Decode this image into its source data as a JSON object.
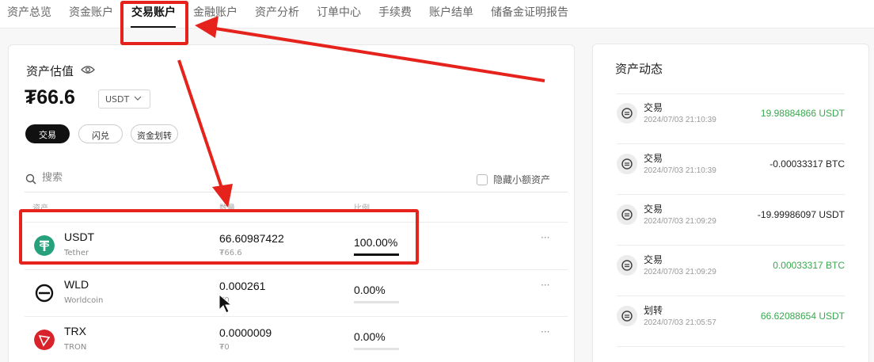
{
  "tabs": [
    {
      "label": "资产总览"
    },
    {
      "label": "资金账户"
    },
    {
      "label": "交易账户"
    },
    {
      "label": "金融账户"
    },
    {
      "label": "资产分析"
    },
    {
      "label": "订单中心"
    },
    {
      "label": "手续费"
    },
    {
      "label": "账户结单"
    },
    {
      "label": "储备金证明报告"
    }
  ],
  "active_tab": "交易账户",
  "valuation": {
    "title": "资产估值",
    "amount": "₮66.6",
    "currency": "USDT"
  },
  "actions": {
    "trade": "交易",
    "flash": "闪兑",
    "transfer": "资金划转"
  },
  "search": {
    "placeholder": "搜索",
    "hide_small_label": "隐藏小额资产"
  },
  "columns": {
    "asset": "资产",
    "amount": "数量",
    "ratio": "比例"
  },
  "assets": [
    {
      "symbol": "USDT",
      "name": "Tether",
      "amount": "66.60987422",
      "sub": "₮66.6",
      "ratio": "100.00%",
      "ratio_value": 1.0,
      "icon": "tether-icon",
      "color": "#26a17b"
    },
    {
      "symbol": "WLD",
      "name": "Worldcoin",
      "amount": "0.000261",
      "sub": "₮0",
      "ratio": "0.00%",
      "ratio_value": 0.0,
      "icon": "worldcoin-icon",
      "color": "#111111"
    },
    {
      "symbol": "TRX",
      "name": "TRON",
      "amount": "0.0000009",
      "sub": "₮0",
      "ratio": "0.00%",
      "ratio_value": 0.0,
      "icon": "tron-icon",
      "color": "#d9232a"
    }
  ],
  "more_label": "···",
  "dynamics": {
    "title": "资产动态",
    "items": [
      {
        "type": "交易",
        "time": "2024/07/03 21:10:39",
        "amount": "19.98884866 USDT",
        "positive": true
      },
      {
        "type": "交易",
        "time": "2024/07/03 21:10:39",
        "amount": "-0.00033317 BTC",
        "positive": false
      },
      {
        "type": "交易",
        "time": "2024/07/03 21:09:29",
        "amount": "-19.99986097 USDT",
        "positive": false
      },
      {
        "type": "交易",
        "time": "2024/07/03 21:09:29",
        "amount": "0.00033317 BTC",
        "positive": true
      },
      {
        "type": "划转",
        "time": "2024/07/03 21:05:57",
        "amount": "66.62088654 USDT",
        "positive": true
      }
    ]
  },
  "colors": {
    "positive": "#38a84e",
    "annotation": "#e5231c"
  }
}
